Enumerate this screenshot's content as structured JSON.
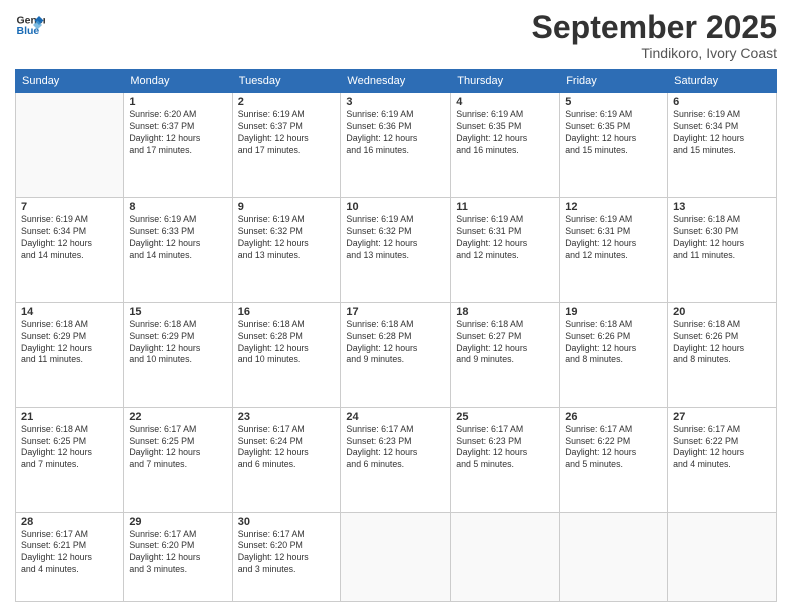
{
  "logo": {
    "line1": "General",
    "line2": "Blue"
  },
  "header": {
    "month": "September 2025",
    "location": "Tindikoro, Ivory Coast"
  },
  "weekdays": [
    "Sunday",
    "Monday",
    "Tuesday",
    "Wednesday",
    "Thursday",
    "Friday",
    "Saturday"
  ],
  "weeks": [
    [
      {
        "day": "",
        "info": ""
      },
      {
        "day": "1",
        "info": "Sunrise: 6:20 AM\nSunset: 6:37 PM\nDaylight: 12 hours\nand 17 minutes."
      },
      {
        "day": "2",
        "info": "Sunrise: 6:19 AM\nSunset: 6:37 PM\nDaylight: 12 hours\nand 17 minutes."
      },
      {
        "day": "3",
        "info": "Sunrise: 6:19 AM\nSunset: 6:36 PM\nDaylight: 12 hours\nand 16 minutes."
      },
      {
        "day": "4",
        "info": "Sunrise: 6:19 AM\nSunset: 6:35 PM\nDaylight: 12 hours\nand 16 minutes."
      },
      {
        "day": "5",
        "info": "Sunrise: 6:19 AM\nSunset: 6:35 PM\nDaylight: 12 hours\nand 15 minutes."
      },
      {
        "day": "6",
        "info": "Sunrise: 6:19 AM\nSunset: 6:34 PM\nDaylight: 12 hours\nand 15 minutes."
      }
    ],
    [
      {
        "day": "7",
        "info": ""
      },
      {
        "day": "8",
        "info": "Sunrise: 6:19 AM\nSunset: 6:33 PM\nDaylight: 12 hours\nand 14 minutes."
      },
      {
        "day": "9",
        "info": "Sunrise: 6:19 AM\nSunset: 6:32 PM\nDaylight: 12 hours\nand 13 minutes."
      },
      {
        "day": "10",
        "info": "Sunrise: 6:19 AM\nSunset: 6:32 PM\nDaylight: 12 hours\nand 13 minutes."
      },
      {
        "day": "11",
        "info": "Sunrise: 6:19 AM\nSunset: 6:31 PM\nDaylight: 12 hours\nand 12 minutes."
      },
      {
        "day": "12",
        "info": "Sunrise: 6:19 AM\nSunset: 6:31 PM\nDaylight: 12 hours\nand 12 minutes."
      },
      {
        "day": "13",
        "info": "Sunrise: 6:18 AM\nSunset: 6:30 PM\nDaylight: 12 hours\nand 11 minutes."
      }
    ],
    [
      {
        "day": "14",
        "info": ""
      },
      {
        "day": "15",
        "info": "Sunrise: 6:18 AM\nSunset: 6:29 PM\nDaylight: 12 hours\nand 10 minutes."
      },
      {
        "day": "16",
        "info": "Sunrise: 6:18 AM\nSunset: 6:28 PM\nDaylight: 12 hours\nand 10 minutes."
      },
      {
        "day": "17",
        "info": "Sunrise: 6:18 AM\nSunset: 6:28 PM\nDaylight: 12 hours\nand 9 minutes."
      },
      {
        "day": "18",
        "info": "Sunrise: 6:18 AM\nSunset: 6:27 PM\nDaylight: 12 hours\nand 9 minutes."
      },
      {
        "day": "19",
        "info": "Sunrise: 6:18 AM\nSunset: 6:26 PM\nDaylight: 12 hours\nand 8 minutes."
      },
      {
        "day": "20",
        "info": "Sunrise: 6:18 AM\nSunset: 6:26 PM\nDaylight: 12 hours\nand 8 minutes."
      }
    ],
    [
      {
        "day": "21",
        "info": ""
      },
      {
        "day": "22",
        "info": "Sunrise: 6:17 AM\nSunset: 6:25 PM\nDaylight: 12 hours\nand 7 minutes."
      },
      {
        "day": "23",
        "info": "Sunrise: 6:17 AM\nSunset: 6:24 PM\nDaylight: 12 hours\nand 6 minutes."
      },
      {
        "day": "24",
        "info": "Sunrise: 6:17 AM\nSunset: 6:23 PM\nDaylight: 12 hours\nand 6 minutes."
      },
      {
        "day": "25",
        "info": "Sunrise: 6:17 AM\nSunset: 6:23 PM\nDaylight: 12 hours\nand 5 minutes."
      },
      {
        "day": "26",
        "info": "Sunrise: 6:17 AM\nSunset: 6:22 PM\nDaylight: 12 hours\nand 5 minutes."
      },
      {
        "day": "27",
        "info": "Sunrise: 6:17 AM\nSunset: 6:22 PM\nDaylight: 12 hours\nand 4 minutes."
      }
    ],
    [
      {
        "day": "28",
        "info": "Sunrise: 6:17 AM\nSunset: 6:21 PM\nDaylight: 12 hours\nand 4 minutes."
      },
      {
        "day": "29",
        "info": "Sunrise: 6:17 AM\nSunset: 6:20 PM\nDaylight: 12 hours\nand 3 minutes."
      },
      {
        "day": "30",
        "info": "Sunrise: 6:17 AM\nSunset: 6:20 PM\nDaylight: 12 hours\nand 3 minutes."
      },
      {
        "day": "",
        "info": ""
      },
      {
        "day": "",
        "info": ""
      },
      {
        "day": "",
        "info": ""
      },
      {
        "day": "",
        "info": ""
      }
    ]
  ],
  "week1_day7_info": "Sunrise: 6:19 AM\nSunset: 6:34 PM\nDaylight: 12 hours\nand 14 minutes.",
  "week3_day14_info": "Sunrise: 6:18 AM\nSunset: 6:29 PM\nDaylight: 12 hours\nand 11 minutes.",
  "week4_day21_info": "Sunrise: 6:18 AM\nSunset: 6:25 PM\nDaylight: 12 hours\nand 7 minutes."
}
